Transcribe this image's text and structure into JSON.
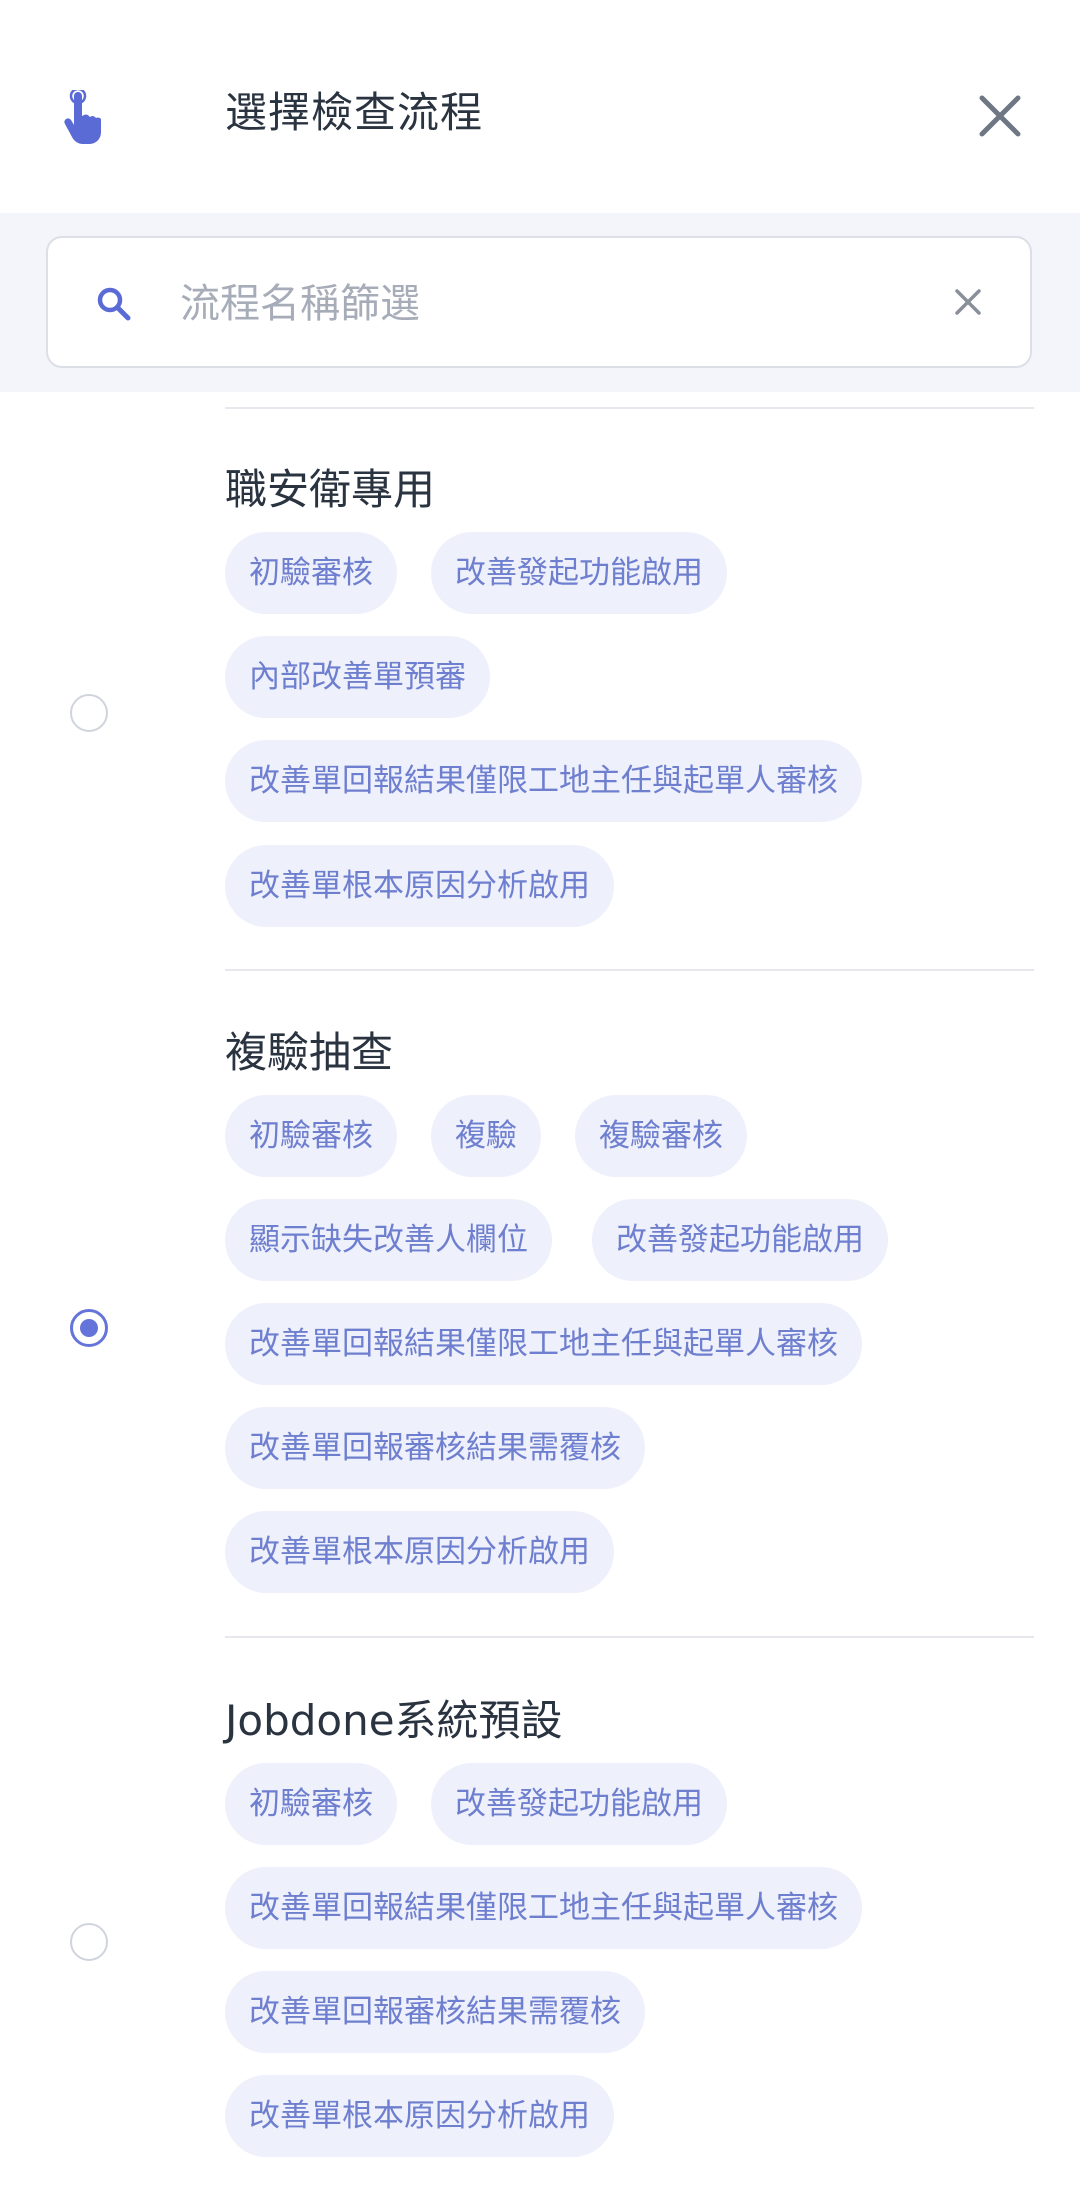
{
  "header": {
    "title": "選擇檢查流程",
    "icon": "hand-pointer-icon",
    "close_icon": "close-icon"
  },
  "search": {
    "placeholder": "流程名稱篩選",
    "value": ""
  },
  "colors": {
    "accent": "#6574d8",
    "chip_bg": "#eef0fb",
    "chip_text": "#6f7fcf",
    "title_text": "#2a3340"
  },
  "flows": [
    {
      "name": "職安衛專用",
      "selected": false,
      "tags": [
        "初驗審核",
        "改善發起功能啟用",
        "內部改善單預審",
        "改善單回報結果僅限工地主任與起單人審核",
        "改善單根本原因分析啟用"
      ]
    },
    {
      "name": "複驗抽查",
      "selected": true,
      "tags": [
        "初驗審核",
        "複驗",
        "複驗審核",
        "顯示缺失改善人欄位",
        "改善發起功能啟用",
        "改善單回報結果僅限工地主任與起單人審核",
        "改善單回報審核結果需覆核",
        "改善單根本原因分析啟用"
      ]
    },
    {
      "name": "Jobdone系統預設",
      "selected": false,
      "tags": [
        "初驗審核",
        "改善發起功能啟用",
        "改善單回報結果僅限工地主任與起單人審核",
        "改善單回報審核結果需覆核",
        "改善單根本原因分析啟用"
      ]
    }
  ]
}
